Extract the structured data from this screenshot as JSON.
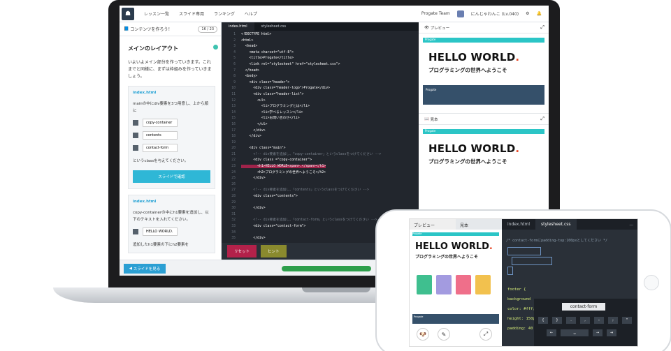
{
  "nav": {
    "menu": [
      "レッスン一覧",
      "スライド専用",
      "ランキング",
      "ヘルプ"
    ],
    "team": "Progate Team",
    "user": "にんじゃわんこ (Lv.040)"
  },
  "lesson": {
    "header": "コンテンツを作ろう！",
    "page": "16 / 23",
    "title": "メインのレイアウト",
    "intro": "いよいよメイン部分を作っていきます。これまでと同様に、まずは枠組みを作っていきましょう。",
    "card1": {
      "file": "index.html",
      "text": "mainの中にdiv要素を3つ用意し、上から順に",
      "items": [
        "copy-container",
        "contents",
        "contact-form"
      ],
      "after": "というclassを与えてください。",
      "button": "スライドで確認"
    },
    "card2": {
      "file": "index.html",
      "text": "copy-containerの中にh1要素を追加し、以下のテキストを入れてください。",
      "item": "HELLO WORLD.",
      "after": "追加したh1要素の下にh2要素を"
    },
    "slide_button": "スライドを見る"
  },
  "editor": {
    "tabs": [
      "index.html",
      "stylesheet.css"
    ],
    "reset": "リセット",
    "hint": "ヒント",
    "lines": [
      "<!DOCTYPE html>",
      "<html>",
      "  <head>",
      "    <meta charset=\"utf-8\">",
      "    <title>Progate</title>",
      "    <link rel=\"stylesheet\" href=\"stylesheet.css\">",
      "  </head>",
      "  <body>",
      "    <div class=\"header\">",
      "      <div class=\"header-logo\">Progate</div>",
      "      <div class=\"header-list\">",
      "        <ul>",
      "          <li>プログラミングとは</li>",
      "          <li>学べるレッスン</li>",
      "          <li>お問い合わせ</li>",
      "        </ul>",
      "      </div>",
      "    </div>",
      "",
      "    <div class=\"main\">",
      "      <!-- div要素を追加し、「copy-container」というclassをつけてください -->",
      "      <div class =\"copy-container\">",
      "        <h1>HELLO WORLD<span>.</span></h1>",
      "        <h2>プログラミングの世界へようこそ</h2>",
      "      </div>",
      "",
      "      <!-- div要素を追加し、「contents」というclassをつけてください -->",
      "      <div class=\"contents\">",
      "",
      "      </div>",
      "",
      "      <!-- div要素を追加し、「contact-form」というclassをつけてください -->",
      "      <div class=\"contact-form\">",
      "",
      "      </div>"
    ]
  },
  "preview": {
    "header": "プレビュー",
    "header2": "見本",
    "brand": "Progate",
    "hello": "HELLO WORLD",
    "dot": ".",
    "jp": "プログラミングの世界へようこそ"
  },
  "phone": {
    "tabs_left": [
      "プレビュー",
      "見本"
    ],
    "tabs_right": [
      "index.html",
      "stylesheet.css"
    ],
    "more": "...",
    "hello": "HELLO WORLD",
    "dot": ".",
    "jp": "プログラミングの世界へようこそ",
    "comment": "/* contact-formにpadding-top:100pxとしてください */",
    "css": [
      "footer {",
      "  background",
      "  color: #fff;",
      "  height: 150p",
      "  padding: 40"
    ],
    "keyboard_word": "contact-form",
    "keys_row1": [
      "{",
      "}",
      ".",
      ",",
      ":",
      ";",
      "\""
    ],
    "keys_row2": [
      "←",
      "␣",
      "→",
      "⇥"
    ]
  }
}
